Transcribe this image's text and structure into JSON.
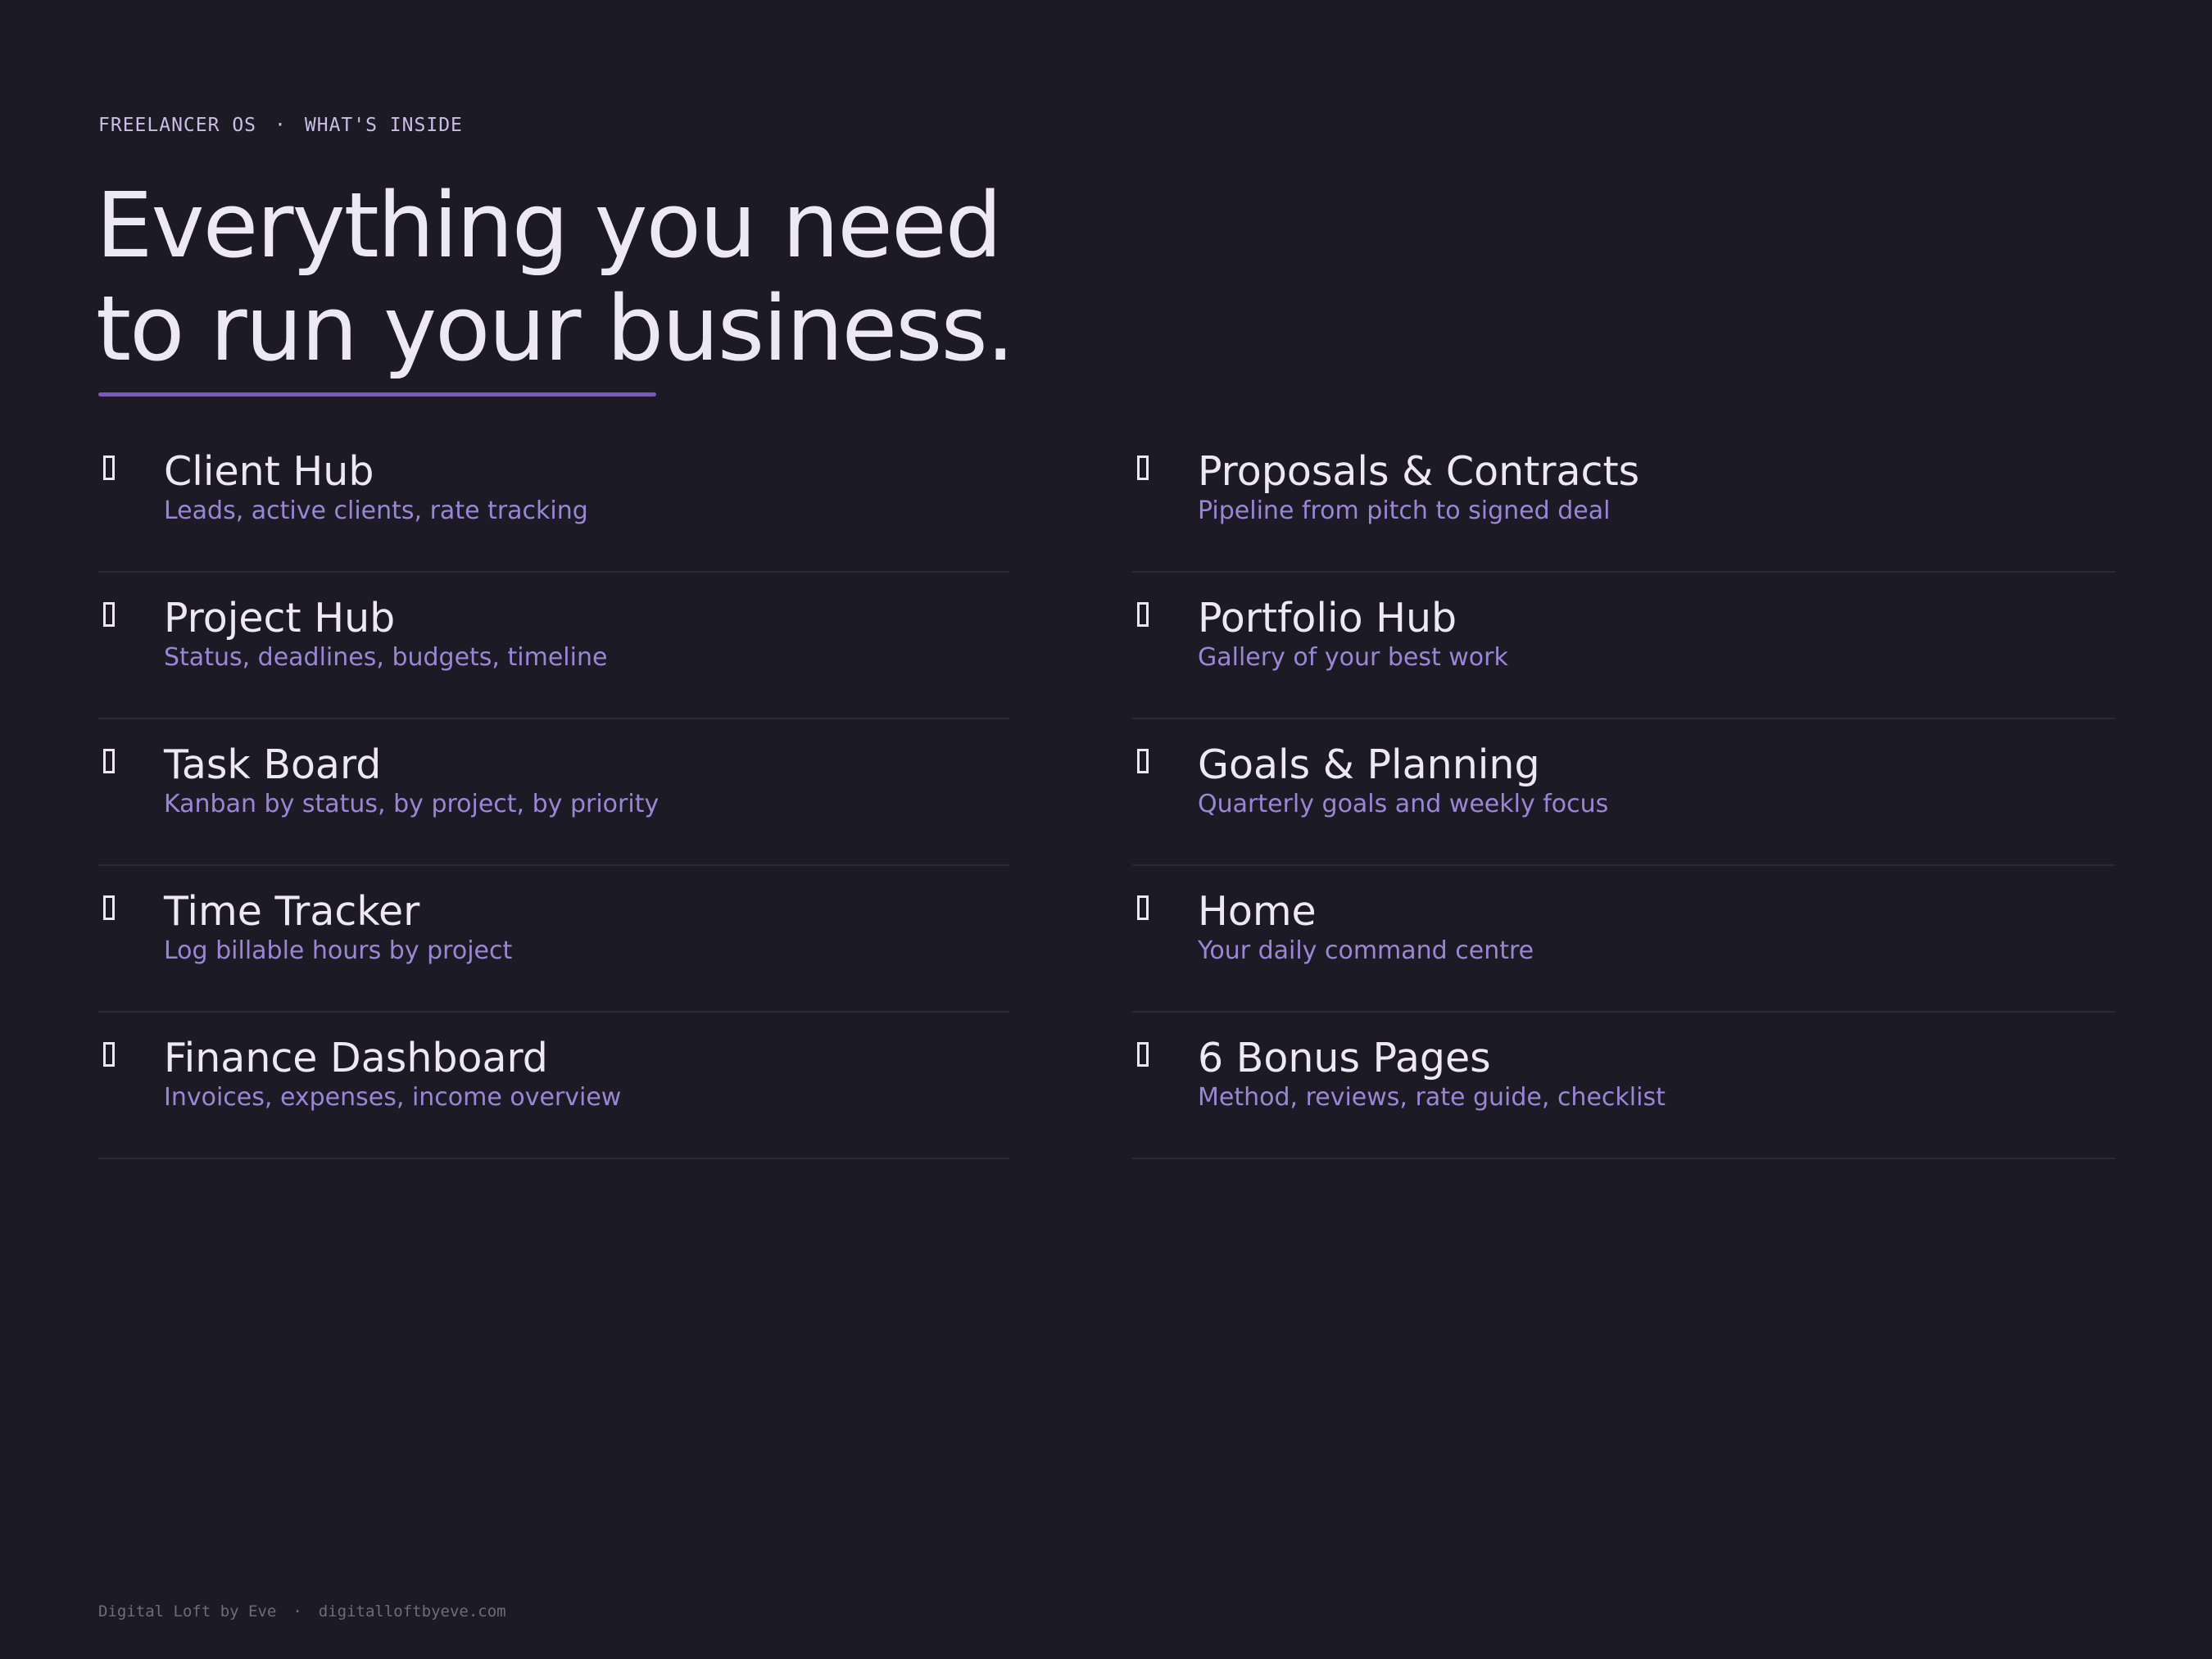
{
  "header": {
    "brand": "FREELANCER OS",
    "separator": "·",
    "section": "WHAT'S INSIDE"
  },
  "headline": {
    "line1": "Everything you need",
    "line2": "to run your business."
  },
  "features": [
    {
      "icon": "page-icon",
      "title": "Client Hub",
      "description": "Leads, active clients, rate tracking"
    },
    {
      "icon": "page-icon",
      "title": "Proposals & Contracts",
      "description": "Pipeline from pitch to signed deal"
    },
    {
      "icon": "page-icon",
      "title": "Project Hub",
      "description": "Status, deadlines, budgets, timeline"
    },
    {
      "icon": "page-icon",
      "title": "Portfolio Hub",
      "description": "Gallery of your best work"
    },
    {
      "icon": "page-icon",
      "title": "Task Board",
      "description": "Kanban by status, by project, by priority"
    },
    {
      "icon": "page-icon",
      "title": "Goals & Planning",
      "description": "Quarterly goals and weekly focus"
    },
    {
      "icon": "page-icon",
      "title": "Time Tracker",
      "description": "Log billable hours by project"
    },
    {
      "icon": "page-icon",
      "title": "Home",
      "description": "Your daily command centre"
    },
    {
      "icon": "page-icon",
      "title": "Finance Dashboard",
      "description": "Invoices, expenses, income overview"
    },
    {
      "icon": "page-icon",
      "title": "6 Bonus Pages",
      "description": "Method, reviews, rate guide, checklist"
    }
  ],
  "footer": {
    "author": "Digital Loft by Eve",
    "separator": "·",
    "url": "digitalloftbyeve.com"
  },
  "colors": {
    "background": "#1c1b25",
    "text": "#ece9f5",
    "accent": "#7a57c4",
    "description": "#9b86d6",
    "divider": "#2a2934",
    "footer": "#6e6b7e"
  }
}
